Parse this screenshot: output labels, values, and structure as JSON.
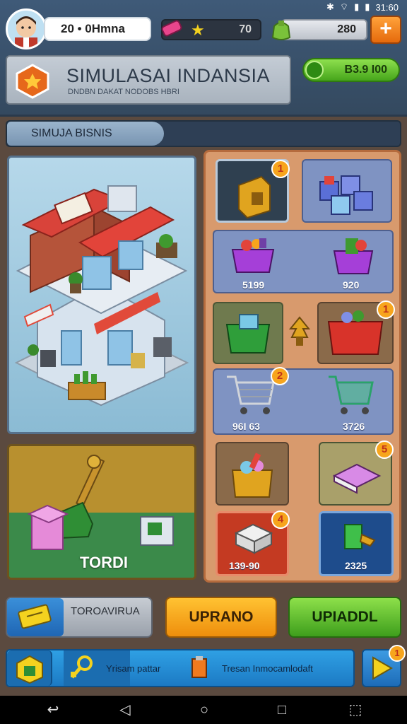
{
  "status_bar": {
    "time": "31:60"
  },
  "header": {
    "player_name": "20 • 0Hmna",
    "gem_value": "70",
    "money_value": "280",
    "plus_label": "+",
    "title": "SIMULASAI INDANSIA",
    "subtitle": "DNDBN DAKAT NODOBS HBRI",
    "cash_value": "B3.9 I00"
  },
  "section": {
    "label": "SIMUJA BISNIS"
  },
  "scenes": {
    "supply_label": "TORDI"
  },
  "grid": {
    "badges": {
      "r1c1": "1",
      "r3c2": "1",
      "r4c1": "2",
      "r5c2": "5",
      "r6c1": "4"
    },
    "prices": {
      "r2c1": "5199",
      "r2c2": "920",
      "r4c1": "96I 63",
      "r4c2": "3726",
      "r6c1": "139-90",
      "r6c2": "2325"
    }
  },
  "buttons": {
    "browse_label": "TOROAVIRUA",
    "upgrade_orange": "UPRANO",
    "upgrade_green": "UPIADDL"
  },
  "bottom_bar": {
    "quest_text": "Yrisam pattar",
    "tool_text": "Tresan Inmocamlodaft",
    "next_badge": "1"
  },
  "colors": {
    "accent_orange": "#f7a51d",
    "accent_green": "#46a51b",
    "panel_blue": "#7f93c2",
    "brown_bg": "#5b4a3f"
  }
}
